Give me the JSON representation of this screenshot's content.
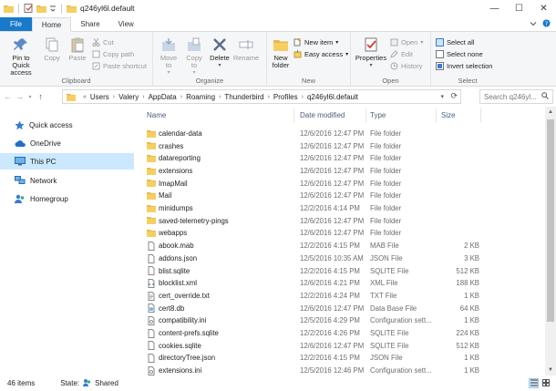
{
  "window": {
    "title": "q246yl6l.default",
    "controls": {
      "minimize": "—",
      "maximize": "☐",
      "close": "✕"
    }
  },
  "ribbon_tabs": {
    "file": "File",
    "home": "Home",
    "share": "Share",
    "view": "View"
  },
  "ribbon": {
    "clipboard": {
      "label": "Clipboard",
      "pin": "Pin to Quick access",
      "copy": "Copy",
      "paste": "Paste",
      "cut": "Cut",
      "copy_path": "Copy path",
      "paste_shortcut": "Paste shortcut"
    },
    "organize": {
      "label": "Organize",
      "move_to": "Move to",
      "copy_to": "Copy to",
      "delete": "Delete",
      "rename": "Rename"
    },
    "new": {
      "label": "New",
      "new_folder": "New folder",
      "new_item": "New item",
      "easy_access": "Easy access"
    },
    "open": {
      "label": "Open",
      "properties": "Properties",
      "open": "Open",
      "edit": "Edit",
      "history": "History"
    },
    "select": {
      "label": "Select",
      "select_all": "Select all",
      "select_none": "Select none",
      "invert_selection": "Invert selection"
    }
  },
  "address": {
    "crumbs": [
      "Users",
      "Valery",
      "AppData",
      "Roaming",
      "Thunderbird",
      "Profiles",
      "q246yl6l.default"
    ],
    "overflow": "«",
    "search_placeholder": "Search q246yl..."
  },
  "nav": {
    "items": [
      {
        "label": "Quick access",
        "icon": "star-icon"
      },
      {
        "label": "OneDrive",
        "icon": "cloud-icon"
      },
      {
        "label": "This PC",
        "icon": "computer-icon",
        "selected": true
      },
      {
        "label": "Network",
        "icon": "network-icon"
      },
      {
        "label": "Homegroup",
        "icon": "homegroup-icon"
      }
    ]
  },
  "columns": {
    "name": "Name",
    "date": "Date modified",
    "type": "Type",
    "size": "Size"
  },
  "files": [
    {
      "name": "calendar-data",
      "date": "12/6/2016 12:47 PM",
      "type": "File folder",
      "size": "",
      "kind": "folder"
    },
    {
      "name": "crashes",
      "date": "12/6/2016 12:47 PM",
      "type": "File folder",
      "size": "",
      "kind": "folder"
    },
    {
      "name": "datareporting",
      "date": "12/6/2016 12:47 PM",
      "type": "File folder",
      "size": "",
      "kind": "folder"
    },
    {
      "name": "extensions",
      "date": "12/6/2016 12:47 PM",
      "type": "File folder",
      "size": "",
      "kind": "folder"
    },
    {
      "name": "ImapMail",
      "date": "12/6/2016 12:47 PM",
      "type": "File folder",
      "size": "",
      "kind": "folder"
    },
    {
      "name": "Mail",
      "date": "12/6/2016 12:47 PM",
      "type": "File folder",
      "size": "",
      "kind": "folder"
    },
    {
      "name": "minidumps",
      "date": "12/2/2016 4:14 PM",
      "type": "File folder",
      "size": "",
      "kind": "folder"
    },
    {
      "name": "saved-telemetry-pings",
      "date": "12/6/2016 12:47 PM",
      "type": "File folder",
      "size": "",
      "kind": "folder"
    },
    {
      "name": "webapps",
      "date": "12/6/2016 12:47 PM",
      "type": "File folder",
      "size": "",
      "kind": "folder"
    },
    {
      "name": "abook.mab",
      "date": "12/2/2016 4:15 PM",
      "type": "MAB File",
      "size": "2 KB",
      "kind": "file"
    },
    {
      "name": "addons.json",
      "date": "12/5/2016 10:35 AM",
      "type": "JSON File",
      "size": "3 KB",
      "kind": "file"
    },
    {
      "name": "blist.sqlite",
      "date": "12/2/2016 4:15 PM",
      "type": "SQLITE File",
      "size": "512 KB",
      "kind": "file"
    },
    {
      "name": "blocklist.xml",
      "date": "12/6/2016 4:21 PM",
      "type": "XML File",
      "size": "188 KB",
      "kind": "xml"
    },
    {
      "name": "cert_override.txt",
      "date": "12/2/2016 4:24 PM",
      "type": "TXT File",
      "size": "1 KB",
      "kind": "txt"
    },
    {
      "name": "cert8.db",
      "date": "12/6/2016 12:47 PM",
      "type": "Data Base File",
      "size": "64 KB",
      "kind": "db"
    },
    {
      "name": "compatibility.ini",
      "date": "12/5/2016 4:29 PM",
      "type": "Configuration sett...",
      "size": "1 KB",
      "kind": "ini"
    },
    {
      "name": "content-prefs.sqlite",
      "date": "12/2/2016 4:26 PM",
      "type": "SQLITE File",
      "size": "224 KB",
      "kind": "file"
    },
    {
      "name": "cookies.sqlite",
      "date": "12/6/2016 12:47 PM",
      "type": "SQLITE File",
      "size": "512 KB",
      "kind": "file"
    },
    {
      "name": "directoryTree.json",
      "date": "12/2/2016 4:15 PM",
      "type": "JSON File",
      "size": "1 KB",
      "kind": "file"
    },
    {
      "name": "extensions.ini",
      "date": "12/5/2016 12:46 PM",
      "type": "Configuration sett...",
      "size": "1 KB",
      "kind": "ini"
    }
  ],
  "status": {
    "items": "46 items",
    "state_label": "State:",
    "state_value": "Shared"
  }
}
